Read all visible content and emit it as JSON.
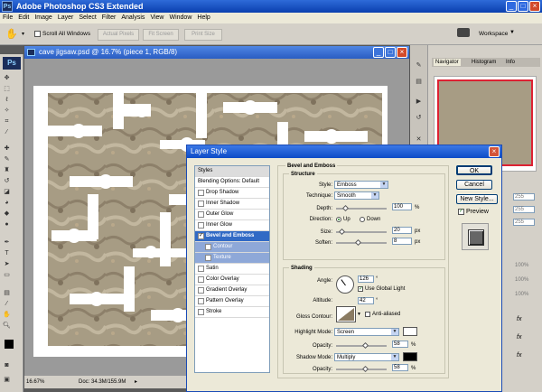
{
  "app": {
    "title": "Adobe Photoshop CS3 Extended",
    "logo": "Ps",
    "menu": [
      "File",
      "Edit",
      "Image",
      "Layer",
      "Select",
      "Filter",
      "Analysis",
      "View",
      "Window",
      "Help"
    ]
  },
  "options_bar": {
    "scroll_all": "Scroll All Windows",
    "actual_pixels": "Actual Pixels",
    "fit_screen": "Fit Screen",
    "print_size": "Print Size",
    "workspace": "Workspace"
  },
  "document": {
    "title": "cave jigsaw.psd @ 16.7% (piece 1, RGB/8)",
    "zoom": "16.67%",
    "doc_size": "Doc: 34.3M/155.9M"
  },
  "panels": {
    "tabs": [
      "Navigator",
      "Histogram",
      "Info"
    ],
    "values": [
      "255",
      "255",
      "255"
    ],
    "percents": [
      "100%",
      "100%",
      "100%"
    ]
  },
  "dialog": {
    "title": "Layer Style",
    "styles_header": "Styles",
    "blending": "Blending Options: Default",
    "items": [
      {
        "label": "Drop Shadow",
        "checked": false
      },
      {
        "label": "Inner Shadow",
        "checked": false
      },
      {
        "label": "Outer Glow",
        "checked": false
      },
      {
        "label": "Inner Glow",
        "checked": false
      },
      {
        "label": "Bevel and Emboss",
        "checked": true
      },
      {
        "label": "Contour",
        "checked": false
      },
      {
        "label": "Texture",
        "checked": false
      },
      {
        "label": "Satin",
        "checked": false
      },
      {
        "label": "Color Overlay",
        "checked": false
      },
      {
        "label": "Gradient Overlay",
        "checked": false
      },
      {
        "label": "Pattern Overlay",
        "checked": false
      },
      {
        "label": "Stroke",
        "checked": false
      }
    ],
    "section_title": "Bevel and Emboss",
    "structure": {
      "title": "Structure",
      "style_label": "Style:",
      "style_value": "Emboss",
      "technique_label": "Technique:",
      "technique_value": "Smooth",
      "depth_label": "Depth:",
      "depth_value": "100",
      "direction_label": "Direction:",
      "up": "Up",
      "down": "Down",
      "size_label": "Size:",
      "size_value": "20",
      "soften_label": "Soften:",
      "soften_value": "8",
      "unit_pct": "%",
      "unit_px": "px"
    },
    "shading": {
      "title": "Shading",
      "angle_label": "Angle:",
      "angle_value": "126",
      "angle_unit": "°",
      "global_light": "Use Global Light",
      "altitude_label": "Altitude:",
      "altitude_value": "42",
      "gloss_label": "Gloss Contour:",
      "anti_aliased": "Anti-aliased",
      "highlight_label": "Highlight Mode:",
      "highlight_value": "Screen",
      "opacity_label": "Opacity:",
      "highlight_opacity": "58",
      "shadow_label": "Shadow Mode:",
      "shadow_value": "Multiply",
      "shadow_opacity": "58"
    },
    "buttons": {
      "ok": "OK",
      "cancel": "Cancel",
      "new_style": "New Style...",
      "preview": "Preview"
    },
    "colors": {
      "highlight": "#ffffff",
      "shadow": "#000000"
    }
  }
}
